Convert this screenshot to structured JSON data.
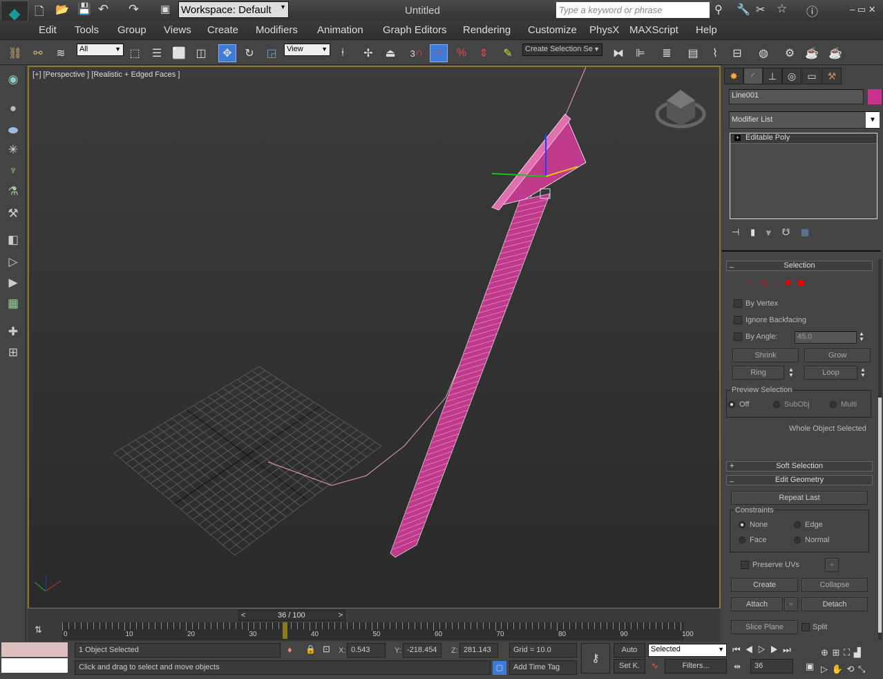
{
  "title": {
    "app": "Untitled",
    "workspace": "Workspace: Default",
    "search_placeholder": "Type a keyword or phrase"
  },
  "menu": [
    "Edit",
    "Tools",
    "Group",
    "Views",
    "Create",
    "Modifiers",
    "Animation",
    "Graph Editors",
    "Rendering",
    "Customize",
    "PhysX",
    "MAXScript",
    "Help"
  ],
  "toolbar": {
    "filter": "All",
    "ref_coord": "View",
    "snap_num": "3",
    "named_sel": "Create Selection Se"
  },
  "viewport": {
    "label": "[+] [Perspective ] [Realistic + Edged Faces ]",
    "colors": {
      "object": "#c03a8c",
      "grid": "#5a5a5a",
      "border": "#8c7a2a"
    }
  },
  "panel": {
    "object_name": "Line001",
    "object_color": "#c8328c",
    "modifier_list": "Modifier List",
    "stack": [
      "Editable Poly"
    ],
    "selection": {
      "title": "Selection",
      "by_vertex": "By Vertex",
      "ignore_backfacing": "Ignore Backfacing",
      "by_angle": "By Angle:",
      "angle": "45.0",
      "shrink": "Shrink",
      "grow": "Grow",
      "ring": "Ring",
      "loop": "Loop",
      "preview": "Preview Selection",
      "off": "Off",
      "subobj": "SubObj",
      "multi": "Multi",
      "status": "Whole Object Selected"
    },
    "soft_selection": "Soft Selection",
    "edit_geometry": {
      "title": "Edit Geometry",
      "repeat_last": "Repeat Last",
      "constraints": "Constraints",
      "none": "None",
      "edge": "Edge",
      "face": "Face",
      "normal": "Normal",
      "preserve_uvs": "Preserve UVs",
      "create": "Create",
      "collapse": "Collapse",
      "attach": "Attach",
      "detach": "Detach",
      "slice_plane": "Slice Plane",
      "split": "Split"
    }
  },
  "timeline": {
    "frame": "36 / 100",
    "current": 36,
    "total": 100,
    "ticks": [
      "0",
      "10",
      "20",
      "30",
      "40",
      "50",
      "60",
      "70",
      "80",
      "90",
      "100"
    ]
  },
  "status": {
    "selected": "1 Object Selected",
    "prompt": "Click and drag to select and move objects",
    "x_label": "X:",
    "x": "0.543",
    "y_label": "Y:",
    "y": "-218.454",
    "z_label": "Z:",
    "z": "281.143",
    "grid": "Grid = 10.0",
    "add_time_tag": "Add Time Tag",
    "auto": "Auto",
    "setk": "Set K.",
    "key_filter": "Selected",
    "filters": "Filters...",
    "frame": "36"
  }
}
